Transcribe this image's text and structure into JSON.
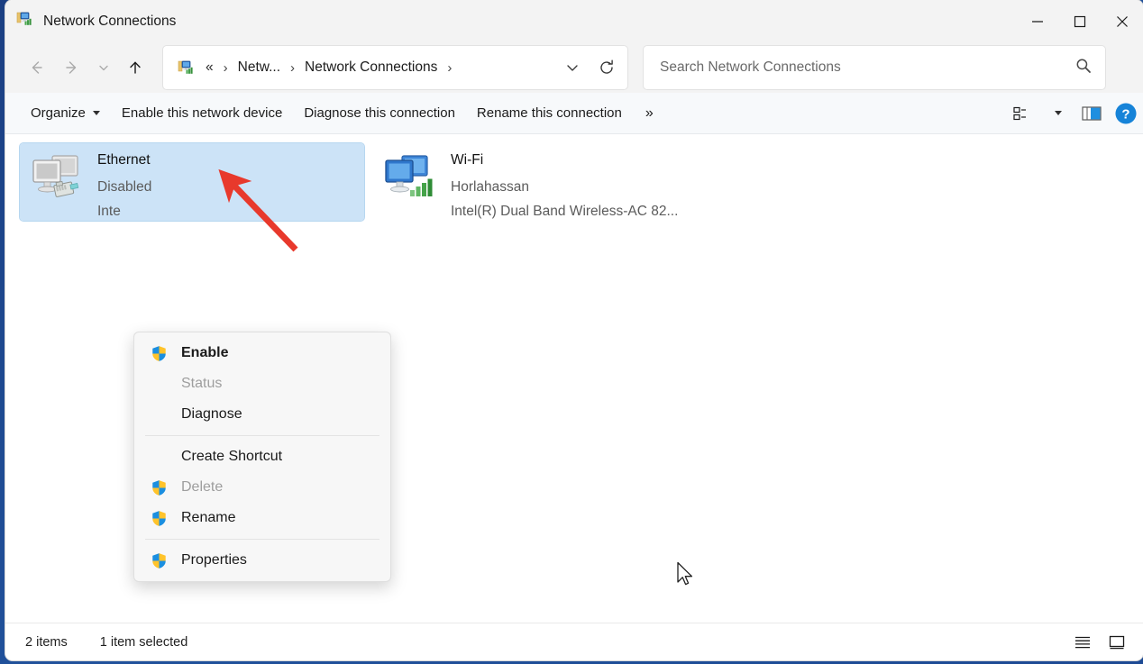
{
  "window": {
    "title": "Network Connections",
    "app_icon": "network-connections-icon",
    "controls": {
      "minimize": "minimize-button",
      "maximize": "maximize-button",
      "close": "close-button"
    }
  },
  "nav": {
    "back": "Back",
    "forward": "Forward",
    "recent": "Recent locations",
    "up": "Up",
    "breadcrumbs": [
      {
        "label": "«",
        "type": "overflow"
      },
      {
        "label": "Netw...",
        "type": "crumb"
      },
      {
        "label": "Network Connections",
        "type": "crumb"
      }
    ],
    "address_dropdown": "Previous locations",
    "refresh": "Refresh"
  },
  "search": {
    "placeholder": "Search Network Connections",
    "value": "",
    "icon": "search-icon"
  },
  "commandbar": {
    "items": [
      {
        "label": "Organize",
        "has_caret": true
      },
      {
        "label": "Enable this network device",
        "has_caret": false
      },
      {
        "label": "Diagnose this connection",
        "has_caret": false
      },
      {
        "label": "Rename this connection",
        "has_caret": false
      }
    ],
    "overflow": "»",
    "view_button": "View",
    "preview_pane_button": "Preview pane",
    "help_button": "Help"
  },
  "items": [
    {
      "name": "Ethernet",
      "status": "Disabled",
      "adapter": "Inte",
      "icon": "ethernet-adapter-icon",
      "selected": true
    },
    {
      "name": "Wi-Fi",
      "status": "Horlahassan",
      "adapter": "Intel(R) Dual Band Wireless-AC 82...",
      "icon": "wifi-adapter-icon",
      "selected": false
    }
  ],
  "context_menu": {
    "groups": [
      [
        {
          "label": "Enable",
          "shield": true,
          "disabled": false,
          "bold": true
        },
        {
          "label": "Status",
          "shield": false,
          "disabled": true,
          "bold": false
        },
        {
          "label": "Diagnose",
          "shield": false,
          "disabled": false,
          "bold": false
        }
      ],
      [
        {
          "label": "Create Shortcut",
          "shield": false,
          "disabled": false,
          "bold": false
        },
        {
          "label": "Delete",
          "shield": true,
          "disabled": true,
          "bold": false
        },
        {
          "label": "Rename",
          "shield": true,
          "disabled": false,
          "bold": false
        }
      ],
      [
        {
          "label": "Properties",
          "shield": true,
          "disabled": false,
          "bold": false
        }
      ]
    ]
  },
  "statusbar": {
    "item_count": "2 items",
    "selection": "1 item selected",
    "details_view_button": "details-view",
    "large_icons_view_button": "large-icons-view"
  },
  "annotation": {
    "arrow_color": "#e8392c",
    "points_to": "Enable"
  },
  "colors": {
    "selection": "#cce3f7",
    "accent": "#0078d4",
    "chrome": "#f3f3f3",
    "commandbar": "#f7f9fb"
  }
}
